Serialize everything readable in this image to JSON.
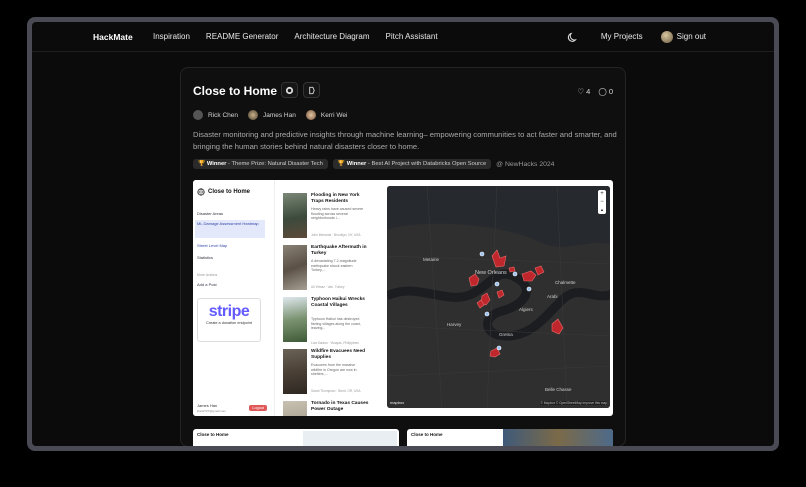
{
  "nav": {
    "brand": "HackMate",
    "links": [
      "Inspiration",
      "README Generator",
      "Architecture Diagram",
      "Pitch Assistant"
    ],
    "my_projects": "My Projects",
    "sign_out": "Sign out"
  },
  "project": {
    "title": "Close to Home",
    "likes": "4",
    "comments": "0",
    "members": [
      "Rick Chen",
      "James Han",
      "Kerri Wei"
    ],
    "description": "Disaster monitoring and predictive insights through machine learning– empowering communities to act faster and smarter, and bringing the human stories behind natural disasters closer to home.",
    "badges": [
      {
        "label": "Winner",
        "detail": " - Theme Prize: Natural Disaster Tech"
      },
      {
        "label": "Winner",
        "detail": " - Best AI Project with Databricks Open Source"
      }
    ],
    "event": "@ NewHacks 2024"
  },
  "screenshot": {
    "app_title": "Close to Home",
    "sidebar_items": [
      "Disaster Areas",
      "ML Damage Assessment Heatmap",
      "Street Level Map",
      "Statistics"
    ],
    "more_actions": "More Actions",
    "add_post": "Add a Post",
    "stripe": "stripe",
    "stripe_caption": "Create a donation endpoint",
    "user_name": "James Han",
    "user_email": "jhan0727@gmail.com",
    "logout": "Logout",
    "posts": [
      {
        "title": "Flooding in New York Traps Residents",
        "text": "Heavy rains have caused severe flooding across several neighborhoods i...",
        "author": "John Menards · Brooklyn, NY, USA"
      },
      {
        "title": "Earthquake Aftermath in Turkey",
        "text": "A devastating 7.2-magnitude earthquake struck eastern Turkey,...",
        "author": "Ali Yilmaz · Van, Turkey"
      },
      {
        "title": "Typhoon Haikui Wrecks Coastal Villages",
        "text": "Typhoon Haikui has destroyed fishing villages along the coast, leaving...",
        "author": "Liza Santos · Visayas, Philippines"
      },
      {
        "title": "Wildfire Evacuees Need Supplies",
        "text": "Evacuees from the massive wildfire in Oregon are now in shelters,...",
        "author": "Sarah Thompson · Bend, OR, USA"
      },
      {
        "title": "Tornado in Texas Causes Power Outage",
        "text": "",
        "author": ""
      }
    ],
    "map_labels": [
      "Metairie",
      "New Orleans",
      "Algiers",
      "Chalmette",
      "Arabi",
      "Gretna",
      "Harvey",
      "Belle Chasse"
    ],
    "mapbox": "mapbox",
    "attribution": "© Mapbox © OpenStreetMap  Improve this map"
  },
  "thumbs": [
    "Close to Home",
    "Close to Home"
  ]
}
